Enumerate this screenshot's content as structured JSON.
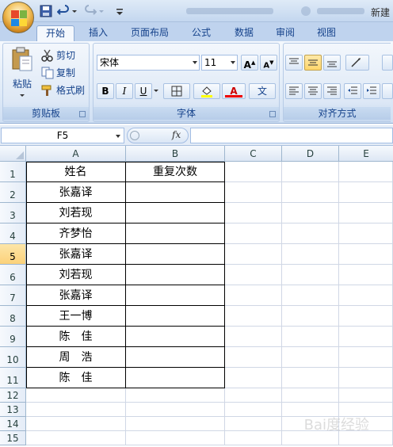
{
  "window": {
    "title_right": "新建"
  },
  "tabs": [
    {
      "label": "开始",
      "active": true
    },
    {
      "label": "插入",
      "active": false
    },
    {
      "label": "页面布局",
      "active": false
    },
    {
      "label": "公式",
      "active": false
    },
    {
      "label": "数据",
      "active": false
    },
    {
      "label": "审阅",
      "active": false
    },
    {
      "label": "视图",
      "active": false
    }
  ],
  "ribbon": {
    "clipboard": {
      "label": "剪贴板",
      "paste": "粘贴",
      "cut": "剪切",
      "copy": "复制",
      "format_painter": "格式刷"
    },
    "font": {
      "label": "字体",
      "font_name": "宋体",
      "font_size": "11",
      "bold": "B",
      "italic": "I",
      "underline": "U",
      "font_color_glyph": "A",
      "phonetic_glyph": "文",
      "grow_glyph": "A",
      "shrink_glyph": "A"
    },
    "alignment": {
      "label": "对齐方式"
    }
  },
  "formula_bar": {
    "name_box": "F5",
    "fx": "fx",
    "value": ""
  },
  "columns": [
    "A",
    "B",
    "C",
    "D",
    "E"
  ],
  "rows": [
    "1",
    "2",
    "3",
    "4",
    "5",
    "6",
    "7",
    "8",
    "9",
    "10",
    "11",
    "12",
    "13",
    "14",
    "15"
  ],
  "selected_row": "5",
  "table": {
    "header": [
      "姓名",
      "重复次数"
    ],
    "names": [
      "张嘉译",
      "刘若现",
      "齐梦怡",
      "张嘉译",
      "刘若现",
      "张嘉译",
      "王一博",
      "陈　佳",
      "周　浩",
      "陈　佳"
    ]
  },
  "watermark": "Bai度经验",
  "colors": {
    "accent": "#15428b",
    "selected_row": "#fbd17a",
    "grid_line": "#d0d7e5"
  }
}
